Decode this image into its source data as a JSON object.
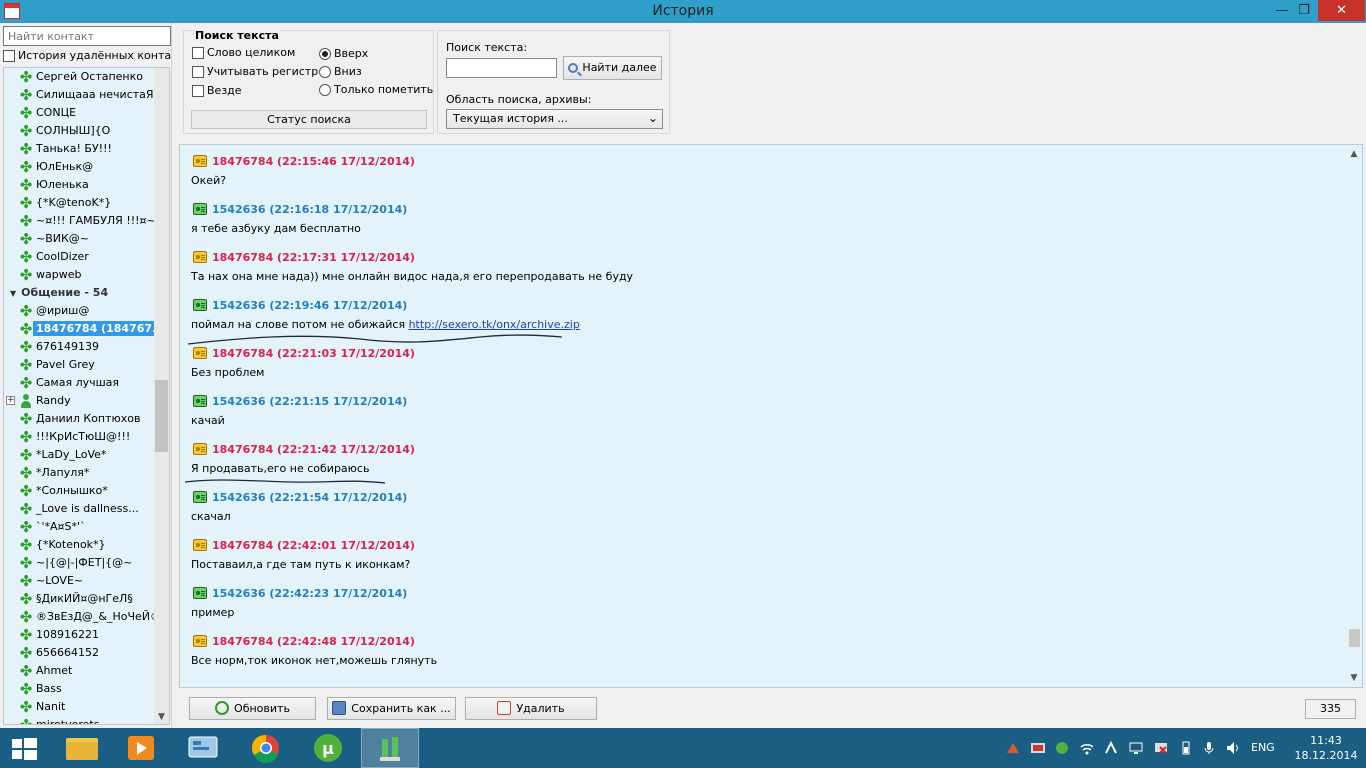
{
  "window": {
    "title": "История",
    "minimize": "—",
    "maximize": "❐",
    "close": "✕"
  },
  "left": {
    "search_placeholder": "Найти контакт",
    "remote_history_label": "История удалённых контакто",
    "contacts_top": [
      "Сергей Остапенко",
      "Силищааа нечистаЯ",
      "CONЦE",
      "СОЛНЫШ]{O",
      "Танька! БУ!!!",
      "ЮлЕньк@",
      "Юленька",
      "{*K@tenoK*}",
      "~¤!!! ГАМБУЛЯ !!!¤~",
      "~ВИК@~",
      "CoolDizer",
      "wapweb"
    ],
    "group_label": "Общение - 54",
    "contacts_group": [
      "@ириш@",
      "18476784 (184767...",
      "676149139",
      "Pavel Grey",
      "Самая лучшая",
      "Randy",
      "Даниил Коптюхов",
      "!!!КрИсТюШ@!!!",
      "*LaDy_LoVe*",
      "*Лапуля*",
      "*Солнышко*",
      "_Love is dallness...",
      "`'*А¤S*'`",
      "{*Kotenok*}",
      "~|{@|-|ФЕТ|{@~",
      "~LOVE~",
      "§ДикИЙ¤@нГеЛ§",
      "®ЗвЕзД@_&_НоЧеЙ®",
      "108916221",
      "656664152",
      "Ahmet",
      "Bass",
      "Nanit",
      "mirotvorets"
    ]
  },
  "search": {
    "legend": "Поиск текста",
    "whole_word": "Слово целиком",
    "match_case": "Учитывать регистр",
    "everywhere": "Везде",
    "up": "Вверх",
    "down": "Вниз",
    "only_mark": "Только пометить",
    "status": "Статус поиска",
    "text_label": "Поиск текста:",
    "find_next": "Найти далее",
    "area_label": "Область поиска, архивы:",
    "area_value": "Текущая история ..."
  },
  "messages": [
    {
      "side": "red",
      "header": "18476784 (22:15:46 17/12/2014)",
      "text": "Окей?"
    },
    {
      "side": "blue",
      "header": "1542636 (22:16:18 17/12/2014)",
      "text": "я тебе азбуку дам бесплатно"
    },
    {
      "side": "red",
      "header": "18476784 (22:17:31 17/12/2014)",
      "text": "Та нах она мне нада)) мне онлайн видос нада,я его перепродавать не буду"
    },
    {
      "side": "blue",
      "header": "1542636 (22:19:46 17/12/2014)",
      "text": "поймал на слове потом не обижайся ",
      "link": "http://sexero.tk/onx/archive.zip"
    },
    {
      "side": "red",
      "header": "18476784 (22:21:03 17/12/2014)",
      "text": "Без проблем"
    },
    {
      "side": "blue",
      "header": "1542636 (22:21:15 17/12/2014)",
      "text": "качай"
    },
    {
      "side": "red",
      "header": "18476784 (22:21:42 17/12/2014)",
      "text": "Я продавать,его не собираюсь"
    },
    {
      "side": "blue",
      "header": "1542636 (22:21:54 17/12/2014)",
      "text": "скачал"
    },
    {
      "side": "red",
      "header": "18476784 (22:42:01 17/12/2014)",
      "text": "Поставаил,а где там путь к иконкам?"
    },
    {
      "side": "blue",
      "header": "1542636 (22:42:23 17/12/2014)",
      "text": "пример"
    },
    {
      "side": "red",
      "header": "18476784 (22:42:48 17/12/2014)",
      "text": "Все норм,ток иконок нет,можешь глянуть"
    }
  ],
  "bottom": {
    "refresh": "Обновить",
    "save_as": "Сохранить как ...",
    "delete": "Удалить",
    "count": "335"
  },
  "taskbar": {
    "lang": "ENG",
    "time": "11:43",
    "date": "18.12.2014"
  },
  "colors": {
    "red_author": "#e0204a",
    "blue_author": "#1d7fc4",
    "history_bg": "#e4f3fa",
    "titlebar": "#2f9ec9",
    "taskbar": "#1b5e83"
  }
}
